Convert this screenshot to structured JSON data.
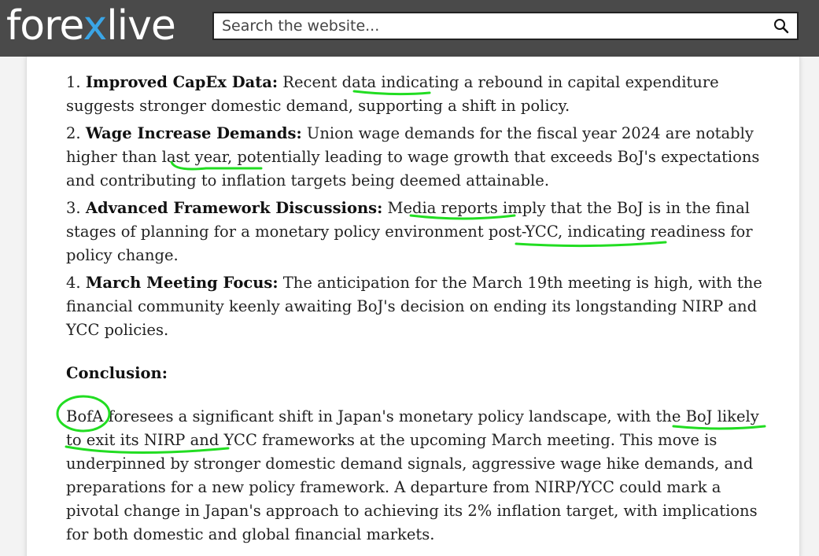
{
  "header": {
    "logo": {
      "part1": "fore",
      "part2": "x",
      "part3": "live"
    },
    "search": {
      "placeholder": "Search the website..."
    },
    "icons": {
      "search": "magnifier-icon"
    },
    "colors": {
      "bar": "#4a4a4a",
      "logo_x": "#3aa5e6",
      "annotation": "#22dd22"
    }
  },
  "article": {
    "items": [
      {
        "num": "1. ",
        "title": "Improved CapEx Data:",
        "text": " Recent data indicating a rebound in capital expenditure suggests stronger domestic demand, supporting a shift in policy."
      },
      {
        "num": "2. ",
        "title": "Wage Increase Demands:",
        "text": " Union wage demands for the fiscal year 2024 are notably higher than last year, potentially leading to wage growth that exceeds BoJ's expectations and contributing to inflation targets being deemed attainable."
      },
      {
        "num": "3. ",
        "title": "Advanced Framework Discussions:",
        "text": " Media reports imply that the BoJ is in the final stages of planning for a monetary policy environment post-YCC, indicating readiness for policy change."
      },
      {
        "num": "4. ",
        "title": "March Meeting Focus:",
        "text": " The anticipation for the March 19th meeting is high, with the financial community keenly awaiting BoJ's decision on ending its longstanding NIRP and YCC policies."
      }
    ],
    "conclusion_heading": "Conclusion:",
    "conclusion_text": "BofA foresees a significant shift in Japan's monetary policy landscape, with the BoJ likely to exit its NIRP and YCC frameworks at the upcoming March meeting. This move is underpinned by stronger domestic demand signals, aggressive wage hike demands, and preparations for a new policy framework. A departure from NIRP/YCC could mark a pivotal change in Japan's approach to achieving its 2% inflation target, with implications for both domestic and global financial markets."
  }
}
